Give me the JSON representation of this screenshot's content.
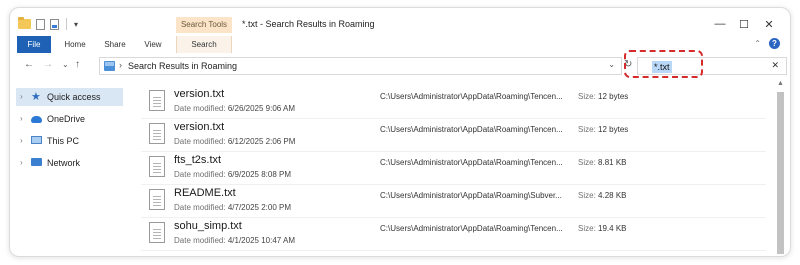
{
  "window": {
    "title": "*.txt - Search Results in Roaming",
    "contextual_tab_header": "Search Tools",
    "controls": {
      "minimize": "—",
      "maximize": "☐",
      "close": "✕"
    }
  },
  "ribbon": {
    "tabs": [
      "File",
      "Home",
      "Share",
      "View",
      "Search"
    ],
    "active_tab": "Search",
    "help": "?",
    "collapse": "⌃"
  },
  "nav_buttons": {
    "back": "←",
    "forward": "→",
    "recent": "⌄",
    "up": "↑"
  },
  "address": {
    "separator": "›",
    "path": "Search Results in Roaming",
    "dropdown": "⌄",
    "refresh": "↻"
  },
  "search": {
    "value": "*.txt",
    "clear": "✕"
  },
  "navpane": {
    "items": [
      {
        "label": "Quick access",
        "icon": "star-icon",
        "selected": true
      },
      {
        "label": "OneDrive",
        "icon": "cloud-icon",
        "selected": false
      },
      {
        "label": "This PC",
        "icon": "computer-icon",
        "selected": false
      },
      {
        "label": "Network",
        "icon": "network-icon",
        "selected": false
      }
    ],
    "chevron": "›"
  },
  "results": {
    "date_label": "Date modified:",
    "size_label": "Size:",
    "files": [
      {
        "name": "version.txt",
        "date": "6/26/2025 9:06 AM",
        "path": "C:\\Users\\Administrator\\AppData\\Roaming\\Tencen...",
        "size": "12 bytes"
      },
      {
        "name": "version.txt",
        "date": "6/12/2025 2:06 PM",
        "path": "C:\\Users\\Administrator\\AppData\\Roaming\\Tencen...",
        "size": "12 bytes"
      },
      {
        "name": "fts_t2s.txt",
        "date": "6/9/2025 8:08 PM",
        "path": "C:\\Users\\Administrator\\AppData\\Roaming\\Tencen...",
        "size": "8.81 KB"
      },
      {
        "name": "README.txt",
        "date": "4/7/2025 2:00 PM",
        "path": "C:\\Users\\Administrator\\AppData\\Roaming\\Subver...",
        "size": "4.28 KB"
      },
      {
        "name": "sohu_simp.txt",
        "date": "4/1/2025 10:47 AM",
        "path": "C:\\Users\\Administrator\\AppData\\Roaming\\Tencen...",
        "size": "19.4 KB"
      }
    ]
  },
  "colors": {
    "file_tab": "#1f62b5",
    "contextual_tab": "#fbe4c8",
    "selection": "#d9e6f4",
    "search_highlight": "#b9d7f7",
    "annotation": "#d62b2b"
  }
}
